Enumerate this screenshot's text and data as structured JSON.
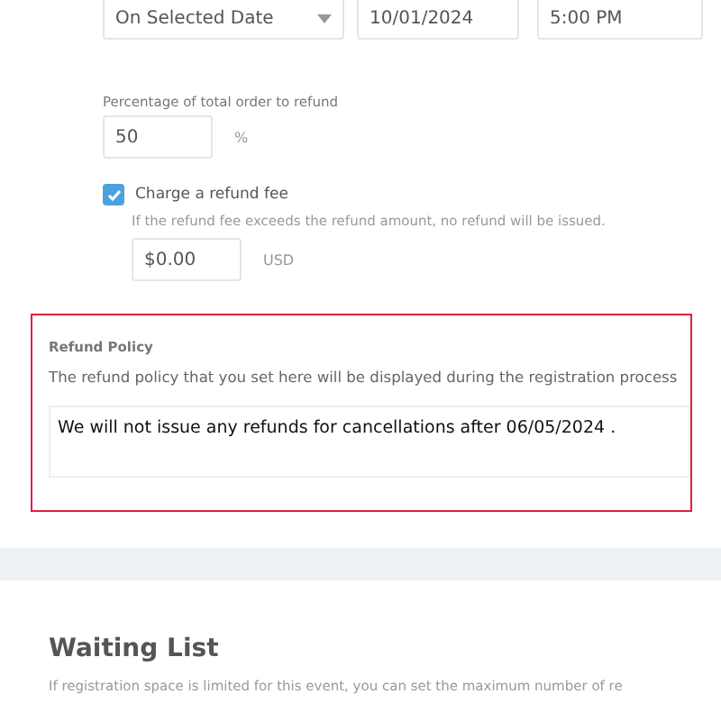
{
  "refund_deadline": {
    "date_option": "On Selected Date",
    "date": "10/01/2024",
    "time": "5:00 PM"
  },
  "percentage": {
    "label": "Percentage of total order to refund",
    "value": "50",
    "unit": "%"
  },
  "refund_fee": {
    "label": "Charge a refund fee",
    "checked": true,
    "hint": "If the refund fee exceeds the refund amount, no refund will be issued.",
    "value": "$0.00",
    "unit": "USD"
  },
  "refund_policy": {
    "title": "Refund Policy",
    "description": "The refund policy that you set here will be displayed during the registration process",
    "value": "We will not issue any refunds for cancellations after 06/05/2024 ."
  },
  "waiting_list": {
    "title": "Waiting List",
    "description": "If registration space is limited for this event, you can set the maximum number of re"
  }
}
